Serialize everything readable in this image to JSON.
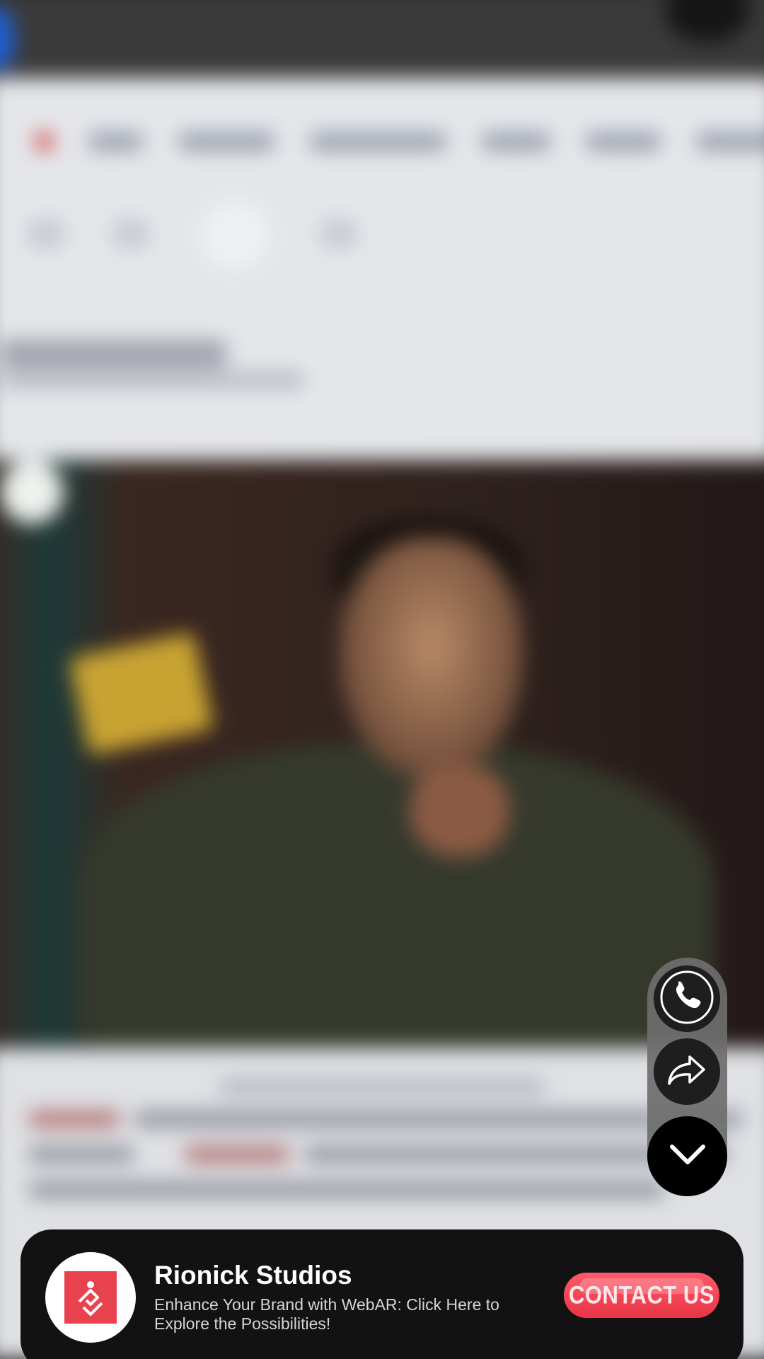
{
  "banner": {
    "brand_name": "Rionick Studios",
    "description": "Enhance Your Brand with WebAR: Click Here to Explore the Possibilities!",
    "cta_label": "CONTACT US",
    "logo_icon": "rionick-logo-icon",
    "accent_color": "#e8424f"
  },
  "actions": {
    "call_icon": "phone-icon",
    "share_icon": "share-forward-icon",
    "collapse_icon": "chevron-down-icon"
  }
}
